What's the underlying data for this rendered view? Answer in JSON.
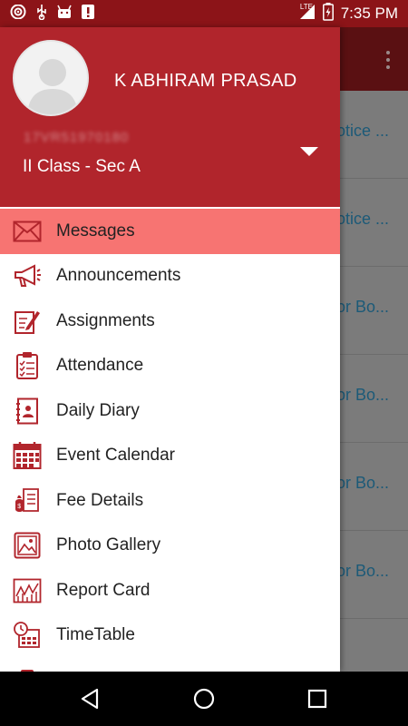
{
  "status_bar": {
    "time": "7:35 PM",
    "network": "LTE",
    "icons": [
      "wifi-icon",
      "usb-icon",
      "android-icon",
      "notification-icon",
      "signal-icon",
      "battery-icon"
    ]
  },
  "background_list": {
    "items": [
      "otice ...",
      "otice ...",
      "or Bo...",
      "or Bo...",
      "or Bo...",
      "or Bo..."
    ]
  },
  "drawer": {
    "user_name": "K ABHIRAM PRASAD",
    "user_id": "17VR51970180",
    "user_class": "II Class - Sec A",
    "menu": [
      {
        "label": "Messages",
        "icon": "envelope-icon",
        "active": true
      },
      {
        "label": "Announcements",
        "icon": "megaphone-icon",
        "active": false
      },
      {
        "label": "Assignments",
        "icon": "pencil-paper-icon",
        "active": false
      },
      {
        "label": "Attendance",
        "icon": "clipboard-checklist-icon",
        "active": false
      },
      {
        "label": "Daily Diary",
        "icon": "diary-icon",
        "active": false
      },
      {
        "label": "Event Calendar",
        "icon": "calendar-icon",
        "active": false
      },
      {
        "label": "Fee Details",
        "icon": "money-receipt-icon",
        "active": false
      },
      {
        "label": "Photo Gallery",
        "icon": "photo-icon",
        "active": false
      },
      {
        "label": "Report Card",
        "icon": "chart-icon",
        "active": false
      },
      {
        "label": "TimeTable",
        "icon": "clock-calendar-icon",
        "active": false
      }
    ]
  },
  "colors": {
    "primary": "#b1252c",
    "status_bar": "#8c1418",
    "active_item": "#f77472",
    "icon": "#b1252c"
  }
}
